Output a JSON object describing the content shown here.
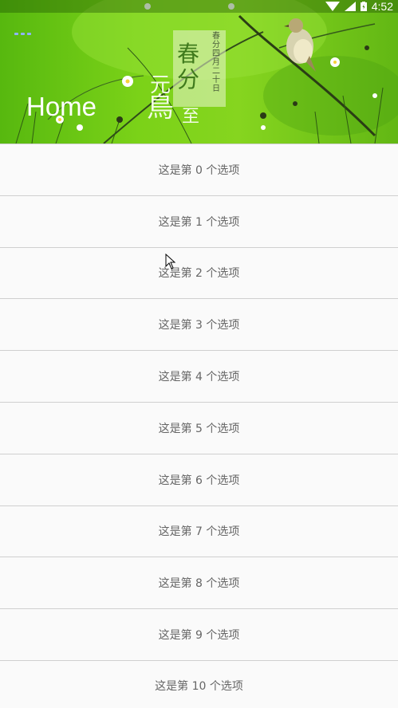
{
  "status_bar": {
    "time": "4:52",
    "icons": [
      "wifi-icon",
      "signal-icon",
      "battery-icon"
    ]
  },
  "header": {
    "title": "Home",
    "banner_poster": {
      "seal_text": "春分",
      "seal_side": "春分四月二十日",
      "calligraphy": [
        "元",
        "鳥",
        "至"
      ]
    },
    "colors": {
      "leaf_green": "#7bd218",
      "dots": "#8fb3ff"
    }
  },
  "list": {
    "items": [
      "这是第 0 个选项",
      "这是第 1 个选项",
      "这是第 2 个选项",
      "这是第 3 个选项",
      "这是第 4 个选项",
      "这是第 5 个选项",
      "这是第 6 个选项",
      "这是第 7 个选项",
      "这是第 8 个选项",
      "这是第 9 个选项",
      "这是第 10 个选项"
    ]
  }
}
